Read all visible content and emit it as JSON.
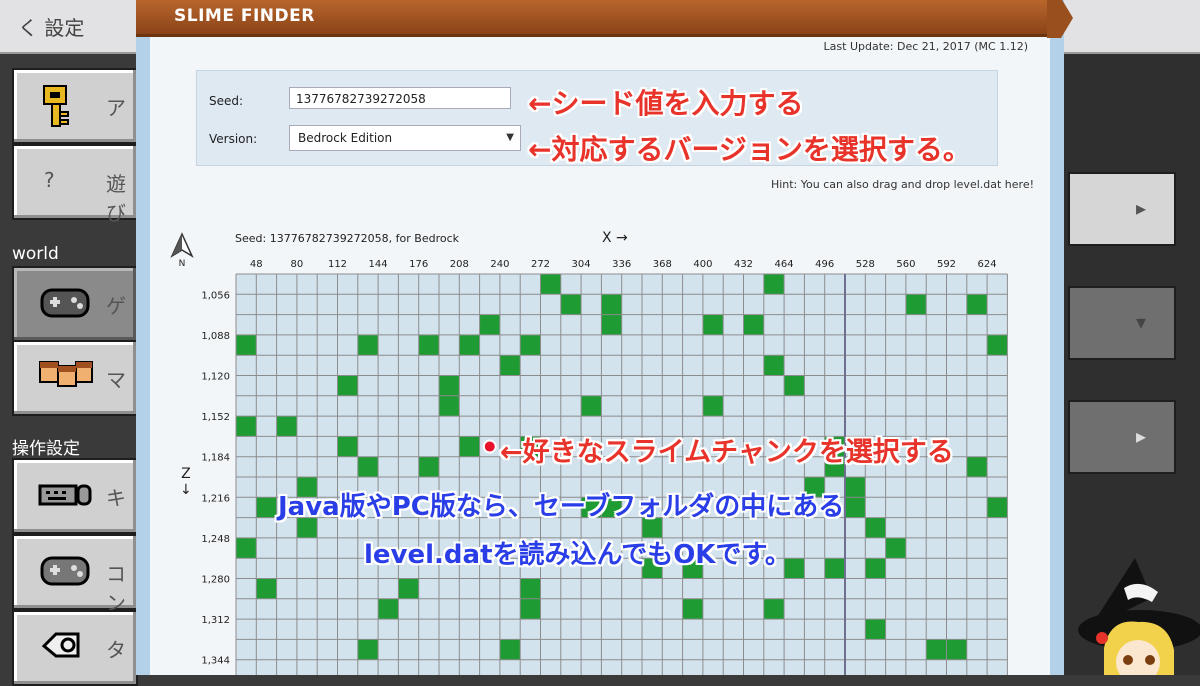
{
  "background": {
    "back_label": "く 設定",
    "left_tiles": [
      {
        "icon": "key-icon",
        "label": "ア"
      },
      {
        "icon": "question-icon",
        "label": "遊び"
      },
      {
        "icon": "controller-icon",
        "label": "ゲ"
      },
      {
        "icon": "faces-icon",
        "label": "マ"
      },
      {
        "icon": "keyboard-icon",
        "label": "キ"
      },
      {
        "icon": "controller-icon",
        "label": "コン"
      },
      {
        "icon": "touch-icon",
        "label": "タ"
      }
    ],
    "section_world": "world",
    "section_controls": "操作設定"
  },
  "panel": {
    "title": "SLIME FINDER",
    "last_update": "Last Update: Dec 21, 2017 (MC 1.12)",
    "seed_label": "Seed:",
    "seed_value": "13776782739272058",
    "version_label": "Version:",
    "version_value": "Bedrock Edition",
    "hint": "Hint: You can also drag and drop level.dat here!",
    "seed_caption": "Seed: 13776782739272058, for Bedrock",
    "north_label": "N",
    "x_axis_label": "X →",
    "z_axis_label": "Z",
    "z_axis_arrow": "↓"
  },
  "map": {
    "x_ticks": [
      "48",
      "80",
      "112",
      "144",
      "176",
      "208",
      "240",
      "272",
      "304",
      "336",
      "368",
      "400",
      "432",
      "464",
      "496",
      "528",
      "560",
      "592",
      "624"
    ],
    "z_ticks": [
      "1,056",
      "1,088",
      "1,120",
      "1,152",
      "1,184",
      "1,216",
      "1,248",
      "1,280",
      "1,312",
      "1,344"
    ],
    "cols": 38,
    "rows": 20,
    "slime_chunks": [
      [
        0,
        15
      ],
      [
        0,
        26
      ],
      [
        1,
        16
      ],
      [
        1,
        18
      ],
      [
        1,
        33
      ],
      [
        1,
        36
      ],
      [
        2,
        12
      ],
      [
        2,
        18
      ],
      [
        2,
        23
      ],
      [
        2,
        25
      ],
      [
        3,
        0
      ],
      [
        3,
        6
      ],
      [
        3,
        9
      ],
      [
        3,
        11
      ],
      [
        3,
        14
      ],
      [
        3,
        37
      ],
      [
        4,
        13
      ],
      [
        4,
        26
      ],
      [
        5,
        5
      ],
      [
        5,
        10
      ],
      [
        5,
        27
      ],
      [
        6,
        10
      ],
      [
        6,
        17
      ],
      [
        6,
        23
      ],
      [
        7,
        0
      ],
      [
        7,
        2
      ],
      [
        8,
        5
      ],
      [
        8,
        11
      ],
      [
        8,
        14
      ],
      [
        8,
        29
      ],
      [
        9,
        6
      ],
      [
        9,
        9
      ],
      [
        9,
        29
      ],
      [
        9,
        36
      ],
      [
        10,
        3
      ],
      [
        10,
        28
      ],
      [
        10,
        30
      ],
      [
        11,
        1
      ],
      [
        11,
        17
      ],
      [
        11,
        18
      ],
      [
        11,
        30
      ],
      [
        11,
        37
      ],
      [
        12,
        3
      ],
      [
        12,
        20
      ],
      [
        12,
        31
      ],
      [
        13,
        0
      ],
      [
        13,
        32
      ],
      [
        14,
        20
      ],
      [
        14,
        22
      ],
      [
        14,
        27
      ],
      [
        14,
        29
      ],
      [
        14,
        31
      ],
      [
        15,
        1
      ],
      [
        15,
        8
      ],
      [
        15,
        14
      ],
      [
        16,
        7
      ],
      [
        16,
        14
      ],
      [
        16,
        22
      ],
      [
        16,
        26
      ],
      [
        17,
        31
      ],
      [
        18,
        6
      ],
      [
        18,
        13
      ],
      [
        18,
        34
      ],
      [
        18,
        35
      ]
    ],
    "selected_chunk": [
      8,
      12
    ],
    "colors": {
      "slime": "#1e9b32",
      "grid_bg": "#d3e3ee",
      "grid_line": "#8c8c8c"
    }
  },
  "annotations": {
    "seed": "←シード値を入力する",
    "version": "←対応するバージョンを選択する。",
    "select": "←好きなスライムチャンクを選択する",
    "java_line1": "Java版やPC版なら、セーブフォルダの中にある",
    "java_line2": "level.datを読み込んでもOKです。"
  }
}
